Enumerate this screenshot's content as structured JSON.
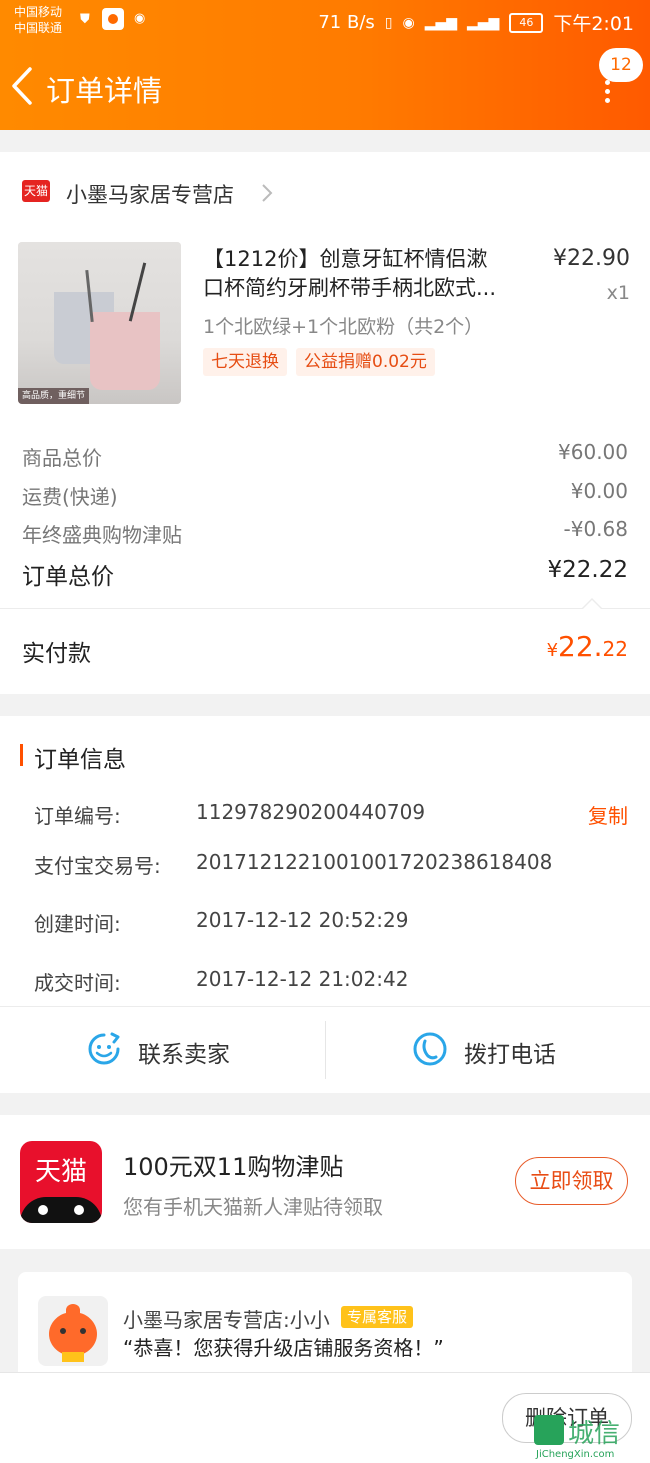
{
  "status_bar": {
    "carrier1": "中国移动",
    "carrier2": "中国联通",
    "net_speed": "71 B/s",
    "battery": "46",
    "time": "下午2:01"
  },
  "header": {
    "title": "订单详情",
    "message_count": "12",
    "bg_color": "#ff7b00"
  },
  "shop": {
    "logo_text": "天猫",
    "name": "小墨马家居专营店"
  },
  "product": {
    "image_caption": "高品质，重细节",
    "title_line1": "【1212价】创意牙缸杯情侣漱",
    "title_line2": "口杯简约牙刷杯带手柄北欧式...",
    "price": "¥22.90",
    "qty": "x1",
    "spec": "1个北欧绿+1个北欧粉（共2个）",
    "tags": [
      "七天退换",
      "公益捐赠0.02元"
    ]
  },
  "price_summary": {
    "rows": [
      {
        "label": "商品总价",
        "value": "¥60.00"
      },
      {
        "label": "运费(快递)",
        "value": "¥0.00"
      },
      {
        "label": "年终盛典购物津贴",
        "value": "-¥0.68"
      }
    ],
    "total_label": "订单总价",
    "total_value": "¥22.22",
    "paid_label": "实付款",
    "paid_currency": "¥",
    "paid_int": "22.",
    "paid_dec": "22"
  },
  "order_info": {
    "title": "订单信息",
    "rows": [
      {
        "label": "订单编号:",
        "value": "112978290200440709"
      },
      {
        "label": "支付宝交易号:",
        "value": "2017121221001001720238618408"
      },
      {
        "label": "创建时间:",
        "value": "2017-12-12 20:52:29"
      },
      {
        "label": "成交时间:",
        "value": "2017-12-12 21:02:42"
      }
    ],
    "copy_label": "复制"
  },
  "actions": {
    "contact_seller": "联系卖家",
    "call_phone": "拨打电话"
  },
  "promo": {
    "logo_text": "天猫",
    "title": "100元双11购物津贴",
    "subtitle": "您有手机天猫新人津贴待领取",
    "button": "立即领取"
  },
  "service": {
    "name": "小墨马家居专营店:小小",
    "badge": "专属客服",
    "message": "“恭喜！您获得升级店铺服务资格！”"
  },
  "bottom": {
    "delete_button": "删除订单",
    "watermark": "城信",
    "watermark_url": "JiChengXin.com"
  }
}
